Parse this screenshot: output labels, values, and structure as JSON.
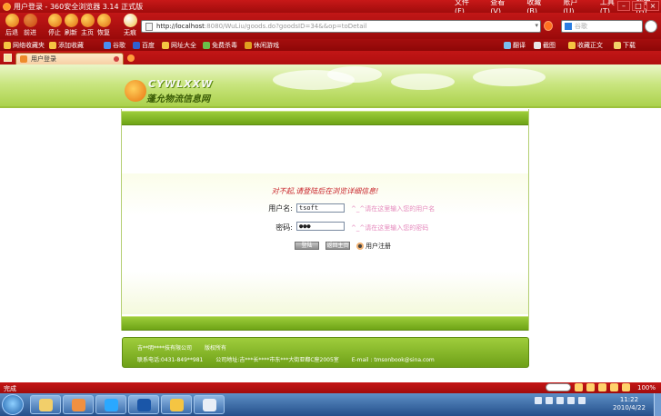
{
  "browser": {
    "window_title": "用户登录 - 360安全浏览器 3.14 正式版",
    "menu": [
      "文件(F)",
      "查看(V)",
      "收藏(B)",
      "账户(U)",
      "工具(T)",
      "帮助(H)"
    ],
    "nav_buttons": [
      {
        "label": "后退",
        "icon": "back-icon"
      },
      {
        "label": "前进",
        "icon": "forward-icon"
      },
      {
        "label": "停止",
        "icon": "stop-icon"
      },
      {
        "label": "刷新",
        "icon": "refresh-icon"
      },
      {
        "label": "主页",
        "icon": "home-icon"
      },
      {
        "label": "恢复",
        "icon": "restore-icon"
      },
      {
        "label": "无痕",
        "icon": "incognito-icon"
      }
    ],
    "address": {
      "prefix": "http://localhost",
      "rest": ":8080/WuLiu/goods.do?goodsID=34&&op=toDetail"
    },
    "search_placeholder": "谷歌",
    "favorites": [
      "网络收藏夹",
      "添加收藏",
      "谷歌",
      "百度",
      "网址大全",
      "免费杀毒",
      "休闲游戏"
    ],
    "favorites_right": [
      "翻译",
      "截图",
      "收藏正文",
      "下载"
    ],
    "tab_title": "用户登录"
  },
  "page": {
    "logo_en": "CYWLXXW",
    "logo_cn": "蓬允物流信息网",
    "notice": "对不起,请登陆后在浏览详细信息!",
    "form": {
      "username_label": "用户名:",
      "username_value": "tsoft",
      "username_hint": "^_^请在这里输入您的用户名",
      "password_label": "密码:",
      "password_value": "●●●",
      "password_hint": "^_^请在这里输入您的密码",
      "login_button": "登陆",
      "home_button": "返回主页",
      "register_link": "用户注册"
    },
    "footer": {
      "company": "吉**明****技有限公司",
      "copyright": "版权所有",
      "phone": "联系电话:0431-849**981",
      "address": "公司地址:吉***长****市东***大街亚都C座2005室",
      "email": "E-mail : tmsonbook@sina.com"
    }
  },
  "statusbar": {
    "status": "完成",
    "zoom": "100%"
  },
  "taskbar": {
    "time": "11:22",
    "date": "2010/4/22"
  },
  "colors": {
    "chrome_red": "#b31212",
    "banner_green": "#a9d048",
    "notice_red": "#c8242a",
    "hint_pink": "#e58abd"
  }
}
